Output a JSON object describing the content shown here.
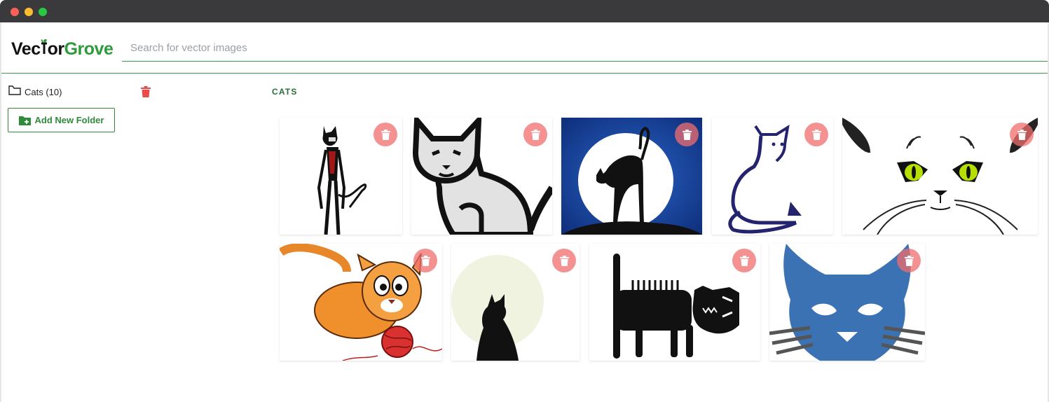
{
  "window": {
    "controls": [
      "close",
      "minimize",
      "maximize"
    ],
    "colors": {
      "close": "#fe5f57",
      "minimize": "#febc2e",
      "maximize": "#28c840"
    }
  },
  "brand": {
    "logo_part1": "Vec",
    "logo_part2": "or",
    "logo_part3": "Grove",
    "accent": "#2f9a3c"
  },
  "search": {
    "placeholder": "Search for vector images",
    "value": ""
  },
  "sidebar": {
    "folders": [
      {
        "label": "Cats (10)",
        "icon": "folder-outline-icon"
      }
    ],
    "add_folder_label": "Add New Folder",
    "add_folder_icon": "folder-plus-icon"
  },
  "main": {
    "section_title": "CATS",
    "images": [
      {
        "name": "skeletal-cat",
        "icon": "trash-icon"
      },
      {
        "name": "line-art-white-cat",
        "icon": "trash-icon"
      },
      {
        "name": "cat-on-moon",
        "icon": "trash-icon"
      },
      {
        "name": "blue-outline-cat",
        "icon": "trash-icon"
      },
      {
        "name": "cat-face-green-eyes",
        "icon": "trash-icon"
      },
      {
        "name": "orange-cat-with-yarn",
        "icon": "trash-icon"
      },
      {
        "name": "black-cat-silhouette",
        "icon": "trash-icon"
      },
      {
        "name": "tribal-striped-cat",
        "icon": "trash-icon"
      },
      {
        "name": "blue-cat-mask",
        "icon": "trash-icon"
      }
    ]
  },
  "colors": {
    "delete_red": "#e84c4c",
    "delete_button_bg": "#f06e6e",
    "green_accent": "#2f8a3b"
  }
}
